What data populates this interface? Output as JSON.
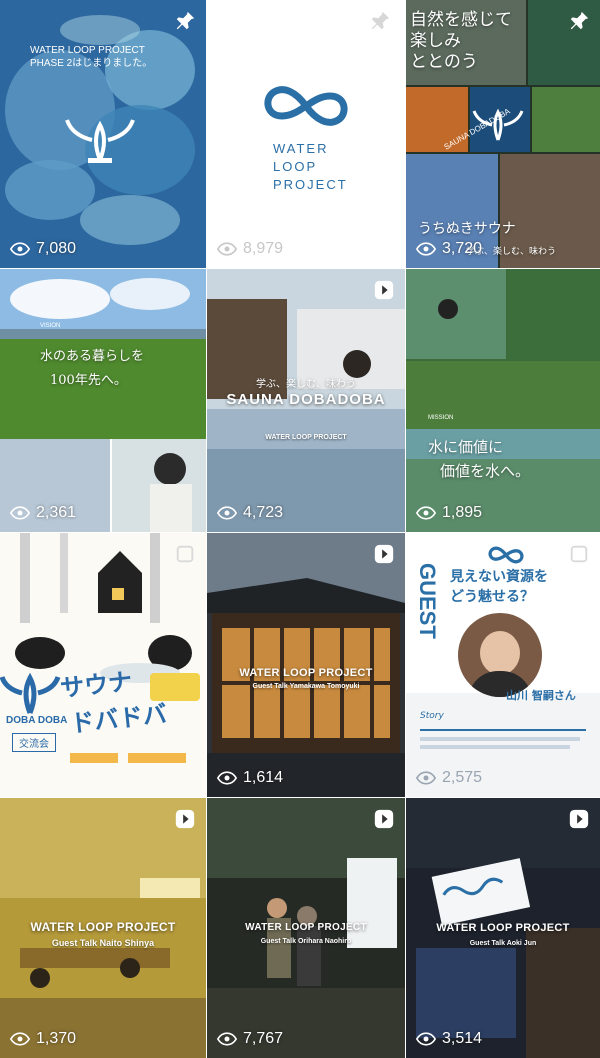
{
  "tiles": [
    {
      "views": "7,080",
      "text": [
        "WATER LOOP PROJECT",
        "PHASE 2はじまりました。"
      ]
    },
    {
      "views": "8,979",
      "text": [
        "WATER",
        "LOOP",
        "PROJECT"
      ]
    },
    {
      "views": "3,720",
      "text": [
        "自然を感じて",
        "楽しみ",
        "ととのう",
        "SAUNA DOBADOBA",
        "うちぬきサウナ",
        "学ぶ、楽しむ、味わう"
      ]
    },
    {
      "views": "2,361",
      "text": [
        "VISION",
        "水のある暮らしを",
        "100年先へ。"
      ]
    },
    {
      "views": "4,723",
      "text": [
        "学ぶ、楽しむ、味わう",
        "SAUNA DOBADOBA",
        "WATER LOOP PROJECT"
      ]
    },
    {
      "views": "1,895",
      "text": [
        "MISSION",
        "水に価値に",
        "価値を水へ。"
      ]
    },
    {
      "views": "",
      "text": [
        "DOBA DOBA",
        "交流会",
        "サウナ",
        "ドバドバ"
      ]
    },
    {
      "views": "1,614",
      "text": [
        "WATER LOOP PROJECT",
        "Guest Talk  Yamakawa Tomoyuki"
      ]
    },
    {
      "views": "2,575",
      "text": [
        "GUEST",
        "見えない資源を",
        "どう魅せる？",
        "山川 智嗣さん",
        "Story"
      ]
    },
    {
      "views": "1,370",
      "text": [
        "WATER LOOP PROJECT",
        "Guest Talk  Naito Shinya"
      ]
    },
    {
      "views": "7,767",
      "text": [
        "WATER LOOP PROJECT",
        "Guest Talk  Orihara Naohiro"
      ]
    },
    {
      "views": "3,514",
      "text": [
        "WATER LOOP PROJECT",
        "Guest Talk  Aoki Jun"
      ]
    }
  ],
  "icons": {
    "view": "eye-icon",
    "pin": "pin-icon",
    "reel": "play-icon"
  },
  "colors": {
    "brand": "#2b5f93",
    "blue": "#2a6aa8"
  }
}
